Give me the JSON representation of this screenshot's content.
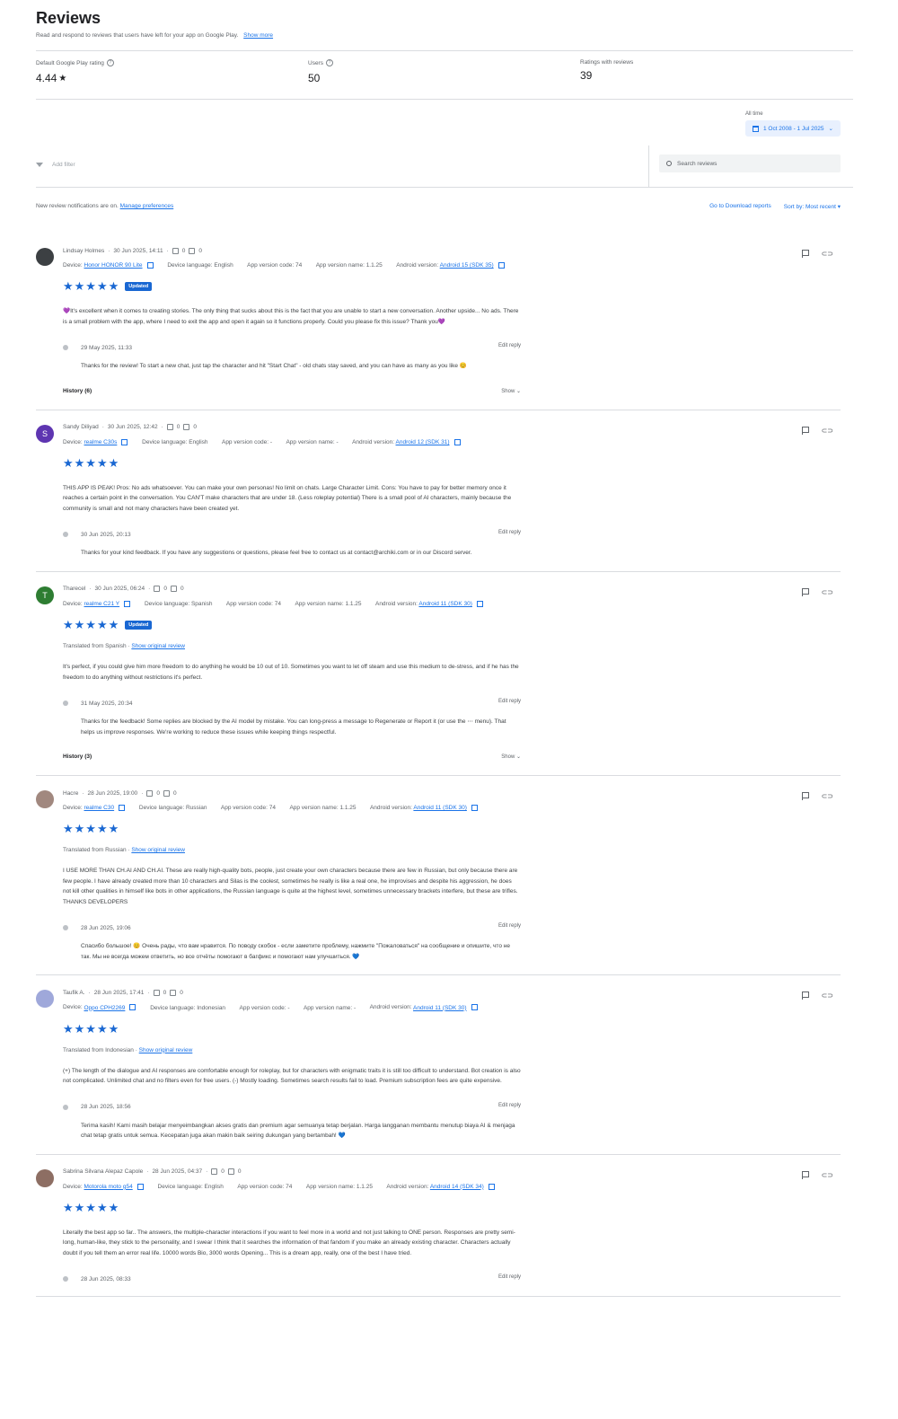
{
  "header": {
    "title": "Reviews",
    "subtitle": "Read and respond to reviews that users have left for your app on Google Play.",
    "show_more": "Show more"
  },
  "stats": {
    "rating_label": "Default Google Play rating",
    "rating_value": "4.44",
    "users_label": "Users",
    "users_value": "50",
    "ratings_label": "Ratings with reviews",
    "ratings_value": "39"
  },
  "range": {
    "label": "All time",
    "value": "1 Oct 2008 - 1 Jul 2025"
  },
  "filters": {
    "add_filter": "Add filter",
    "search_placeholder": "Search reviews"
  },
  "notifications": {
    "text": "New review notifications are on.",
    "manage": "Manage preferences",
    "download": "Go to Download reports",
    "sort": "Sort by: Most recent"
  },
  "reviews": [
    {
      "author": "Lindsay Holmes",
      "date": "30 Jun 2025, 14:11",
      "up": "0",
      "down": "0",
      "avatar_color": "#3c4043",
      "avatar_letter": "",
      "device_label": "Device:",
      "device": "Honor HONOR 90 Lite",
      "language": "Device language: English",
      "app_code": "App version code: 74",
      "app_name": "App version name: 1.1.25",
      "android_label": "Android version:",
      "android": "Android 15 (SDK 35)",
      "stars": "★★★★★",
      "badge": "Updated",
      "translated": "",
      "show_original": "",
      "text": "💜It's excellent when it comes to creating stories. The only thing that sucks about this is the fact that you are unable to start a new conversation. Another upside... No ads. There is a small problem with the app, where I need to exit the app and open it again so it functions properly. Could you please fix this issue? Thank you💜",
      "reply_date": "29 May 2025, 11:33",
      "edit_reply": "Edit reply",
      "reply": "Thanks for the review! To start a new chat, just tap the character and hit \"Start Chat\" - old chats stay saved, and you can have as many as you like 😊",
      "history": "History (6)",
      "show": "Show"
    },
    {
      "author": "Sandy Diliyad",
      "date": "30 Jun 2025, 12:42",
      "up": "0",
      "down": "0",
      "avatar_color": "#5e35b1",
      "avatar_letter": "S",
      "device_label": "Device:",
      "device": "realme C30s",
      "language": "Device language: English",
      "app_code": "App version code: -",
      "app_name": "App version name: -",
      "android_label": "Android version:",
      "android": "Android 12 (SDK 31)",
      "stars": "★★★★★",
      "badge": "",
      "translated": "",
      "show_original": "",
      "text": "THIS APP IS PEAK! Pros: No ads whatsoever. You can make your own personas! No limit on chats. Large Character Limit. Cons: You have to pay for better memory once it reaches a certain point in the conversation. You CAN'T make characters that are under 18. (Less roleplay potential) There is a small pool of AI characters, mainly because the community is small and not many characters have been created yet.",
      "reply_date": "30 Jun 2025, 20:13",
      "edit_reply": "Edit reply",
      "reply": "Thanks for your kind feedback. If you have any suggestions or questions, please feel free to contact us at contact@archiki.com or in our Discord server.",
      "history": "",
      "show": ""
    },
    {
      "author": "Tharecel",
      "date": "30 Jun 2025, 06:24",
      "up": "0",
      "down": "0",
      "avatar_color": "#2e7d32",
      "avatar_letter": "T",
      "device_label": "Device:",
      "device": "realme C21 Y",
      "language": "Device language: Spanish",
      "app_code": "App version code: 74",
      "app_name": "App version name: 1.1.25",
      "android_label": "Android version:",
      "android": "Android 11 (SDK 30)",
      "stars": "★★★★★",
      "badge": "Updated",
      "translated": "Translated from Spanish ·",
      "show_original": "Show original review",
      "text": "It's perfect, if you could give him more freedom to do anything he would be 10 out of 10. Sometimes you want to let off steam and use this medium to de-stress, and if he has the freedom to do anything without restrictions it's perfect.",
      "reply_date": "31 May 2025, 20:34",
      "edit_reply": "Edit reply",
      "reply": "Thanks for the feedback! Some replies are blocked by the AI model by mistake. You can long-press a message to Regenerate or Report it (or use the ⋯ menu). That helps us improve responses. We're working to reduce these issues while keeping things respectful.",
      "history": "History (3)",
      "show": "Show"
    },
    {
      "author": "Hacre",
      "date": "28 Jun 2025, 19:00",
      "up": "0",
      "down": "0",
      "avatar_color": "#a1887f",
      "avatar_letter": "",
      "device_label": "Device:",
      "device": "realme C30",
      "language": "Device language: Russian",
      "app_code": "App version code: 74",
      "app_name": "App version name: 1.1.25",
      "android_label": "Android version:",
      "android": "Android 11 (SDK 30)",
      "stars": "★★★★★",
      "badge": "",
      "translated": "Translated from Russian ·",
      "show_original": "Show original review",
      "text": "I USE MORE THAN CH.AI AND CH.AI. These are really high-quality bots, people, just create your own characters because there are few in Russian, but only because there are few people. I have already created more than 10 characters and Silas is the coolest, sometimes he really is like a real one, he improvises and despite his aggression, he does not kill other qualities in himself like bots in other applications, the Russian language is quite at the highest level, sometimes unnecessary brackets interfere, but these are trifles. THANKS DEVELOPERS",
      "reply_date": "28 Jun 2025, 19:06",
      "edit_reply": "Edit reply",
      "reply": "Спасибо большое! 😊 Очень рады, что вам нравится. По поводу скобок - если заметите проблему, нажмите \"Пожаловаться\" на сообщение и опишите, что не так. Мы не всегда можем ответить, но все отчёты помогают в багфикс и помогают нам улучшиться. 💙",
      "history": "",
      "show": ""
    },
    {
      "author": "Taufik A.",
      "date": "28 Jun 2025, 17:41",
      "up": "0",
      "down": "0",
      "avatar_color": "#9fa8da",
      "avatar_letter": "",
      "device_label": "Device:",
      "device": "Oppo CPH2269",
      "language": "Device language: Indonesian",
      "app_code": "App version code: -",
      "app_name": "App version name: -",
      "android_label": "Android version:",
      "android": "Android 11 (SDK 30)",
      "stars": "★★★★★",
      "badge": "",
      "translated": "Translated from Indonesian ·",
      "show_original": "Show original review",
      "text": "(+) The length of the dialogue and AI responses are comfortable enough for roleplay, but for characters with enigmatic traits it is still too difficult to understand. Bot creation is also not complicated. Unlimited chat and no filters even for free users. (-) Mostly loading. Sometimes search results fail to load. Premium subscription fees are quite expensive.",
      "reply_date": "28 Jun 2025, 18:56",
      "edit_reply": "Edit reply",
      "reply": "Terima kasih! Kami masih belajar menyeimbangkan akses gratis dan premium agar semuanya tetap berjalan. Harga langganan membantu menutup biaya AI & menjaga chat tetap gratis untuk semua. Kecepatan juga akan makin baik seiring dukungan yang bertambah! 💙",
      "history": "",
      "show": ""
    },
    {
      "author": "Sabrina Silvana Alepaz Capole",
      "date": "28 Jun 2025, 04:37",
      "up": "0",
      "down": "0",
      "avatar_color": "#8d6e63",
      "avatar_letter": "",
      "device_label": "Device:",
      "device": "Motorola moto g54",
      "language": "Device language: English",
      "app_code": "App version code: 74",
      "app_name": "App version name: 1.1.25",
      "android_label": "Android version:",
      "android": "Android 14 (SDK 34)",
      "stars": "★★★★★",
      "badge": "",
      "translated": "",
      "show_original": "",
      "text": "Literally the best app so far.. The answers, the multiple-character interactions if you want to feel more in a world and not just talking to ONE person. Responses are pretty semi-long, human-like, they stick to the personality, and I swear I think that it searches the information of that fandom if you make an already existing character. Characters actually doubt if you tell them an error real life. 10000 words Bio, 3000 words Opening... This is a dream app, really, one of the best I have tried.",
      "reply_date": "28 Jun 2025, 08:33",
      "edit_reply": "Edit reply",
      "reply": "",
      "history": "",
      "show": ""
    }
  ]
}
